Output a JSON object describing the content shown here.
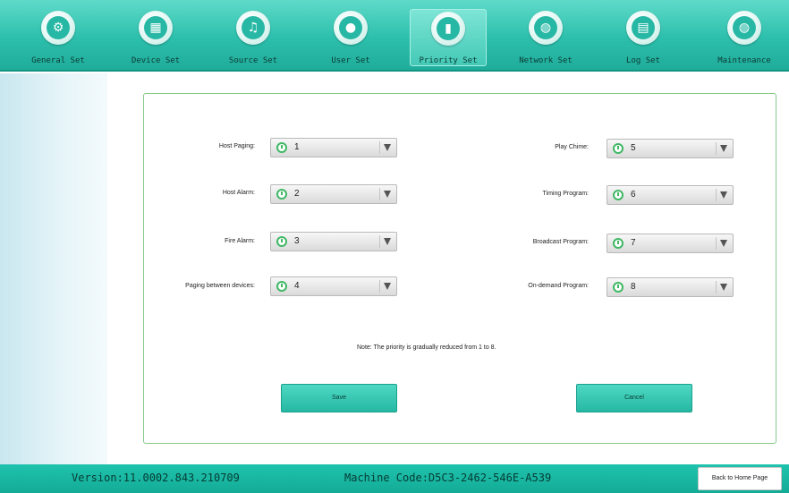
{
  "toolbar": {
    "tabs": [
      {
        "label": "General Set",
        "icon": "gear-icon",
        "glyph": "⚙"
      },
      {
        "label": "Device Set",
        "icon": "grid-icon",
        "glyph": "▦"
      },
      {
        "label": "Source Set",
        "icon": "music-note-icon",
        "glyph": "♫"
      },
      {
        "label": "User Set",
        "icon": "user-icon",
        "glyph": "●"
      },
      {
        "label": "Priority Set",
        "icon": "bar-chart-icon",
        "glyph": "▮"
      },
      {
        "label": "Network Set",
        "icon": "globe-icon",
        "glyph": "◍"
      },
      {
        "label": "Log Set",
        "icon": "document-icon",
        "glyph": "▤"
      },
      {
        "label": "Maintenance",
        "icon": "globe-icon",
        "glyph": "◍"
      }
    ],
    "active_tab": "Priority Set"
  },
  "form": {
    "host_paging": {
      "label": "Host Paging:",
      "value": "1"
    },
    "host_alarm": {
      "label": "Host Alarm:",
      "value": "2"
    },
    "fire_alarm": {
      "label": "Fire Alarm:",
      "value": "3"
    },
    "paging_between": {
      "label": "Paging between devices:",
      "value": "4"
    },
    "play_chime": {
      "label": "Play Chime:",
      "value": "5"
    },
    "timing_program": {
      "label": "Timing Program:",
      "value": "6"
    },
    "broadcast_program": {
      "label": "Broadcast Program:",
      "value": "7"
    },
    "ondemand_program": {
      "label": "On-demand Program:",
      "value": "8"
    },
    "note": "Note: The priority is gradually reduced from 1 to 8.",
    "save_label": "Save",
    "cancel_label": "Cancel"
  },
  "footer": {
    "version": "Version:11.0002.843.210709",
    "machine_code": "Machine Code:D5C3-2462-546E-A539",
    "home_label": "Back to Home Page"
  },
  "colors": {
    "toolbar_top": "#5fdac9",
    "toolbar_bottom": "#20ac9a",
    "accent": "#27b8a5",
    "frame_border": "#86c98a",
    "footer": "#13ab96"
  }
}
